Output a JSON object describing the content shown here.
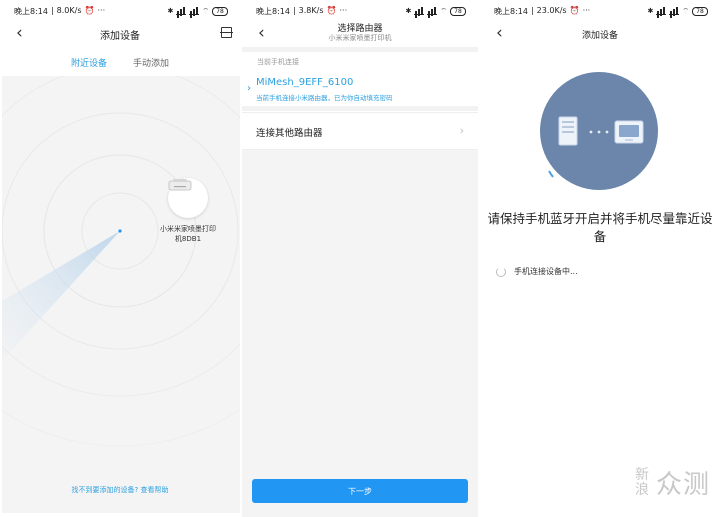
{
  "screen1": {
    "status": {
      "time": "晚上8:14",
      "speed": "8.0K/s",
      "dots": "···",
      "battery": "78"
    },
    "title": "添加设备",
    "tabs": [
      "附近设备",
      "手动添加"
    ],
    "device_label": "小米米家喷墨打印机8DB1",
    "help_link": "找不到要添加的设备? 查看帮助"
  },
  "screen2": {
    "status": {
      "time": "晚上8:14",
      "speed": "3.8K/s",
      "dots": "···",
      "battery": "78"
    },
    "title": "选择路由器",
    "subtitle": "小米米家喷墨打印机",
    "section_label": "当前手机连接",
    "current_network": "MiMesh_9EFF_6100",
    "current_note": "当前手机连接小米路由器，已为你自动填充密码",
    "other_router": "连接其他路由器",
    "next_button": "下一步"
  },
  "screen3": {
    "status": {
      "time": "晚上8:14",
      "speed": "23.0K/s",
      "dots": "···",
      "battery": "78"
    },
    "title": "添加设备",
    "message": "请保持手机蓝牙开启并将手机尽量靠近设备",
    "progress_text": "手机连接设备中..."
  },
  "watermark": {
    "small": "新浪",
    "large": "众测"
  },
  "colors": {
    "accent": "#2196f3",
    "accent_text": "#2ba0e0",
    "circle": "#6b86aa"
  }
}
